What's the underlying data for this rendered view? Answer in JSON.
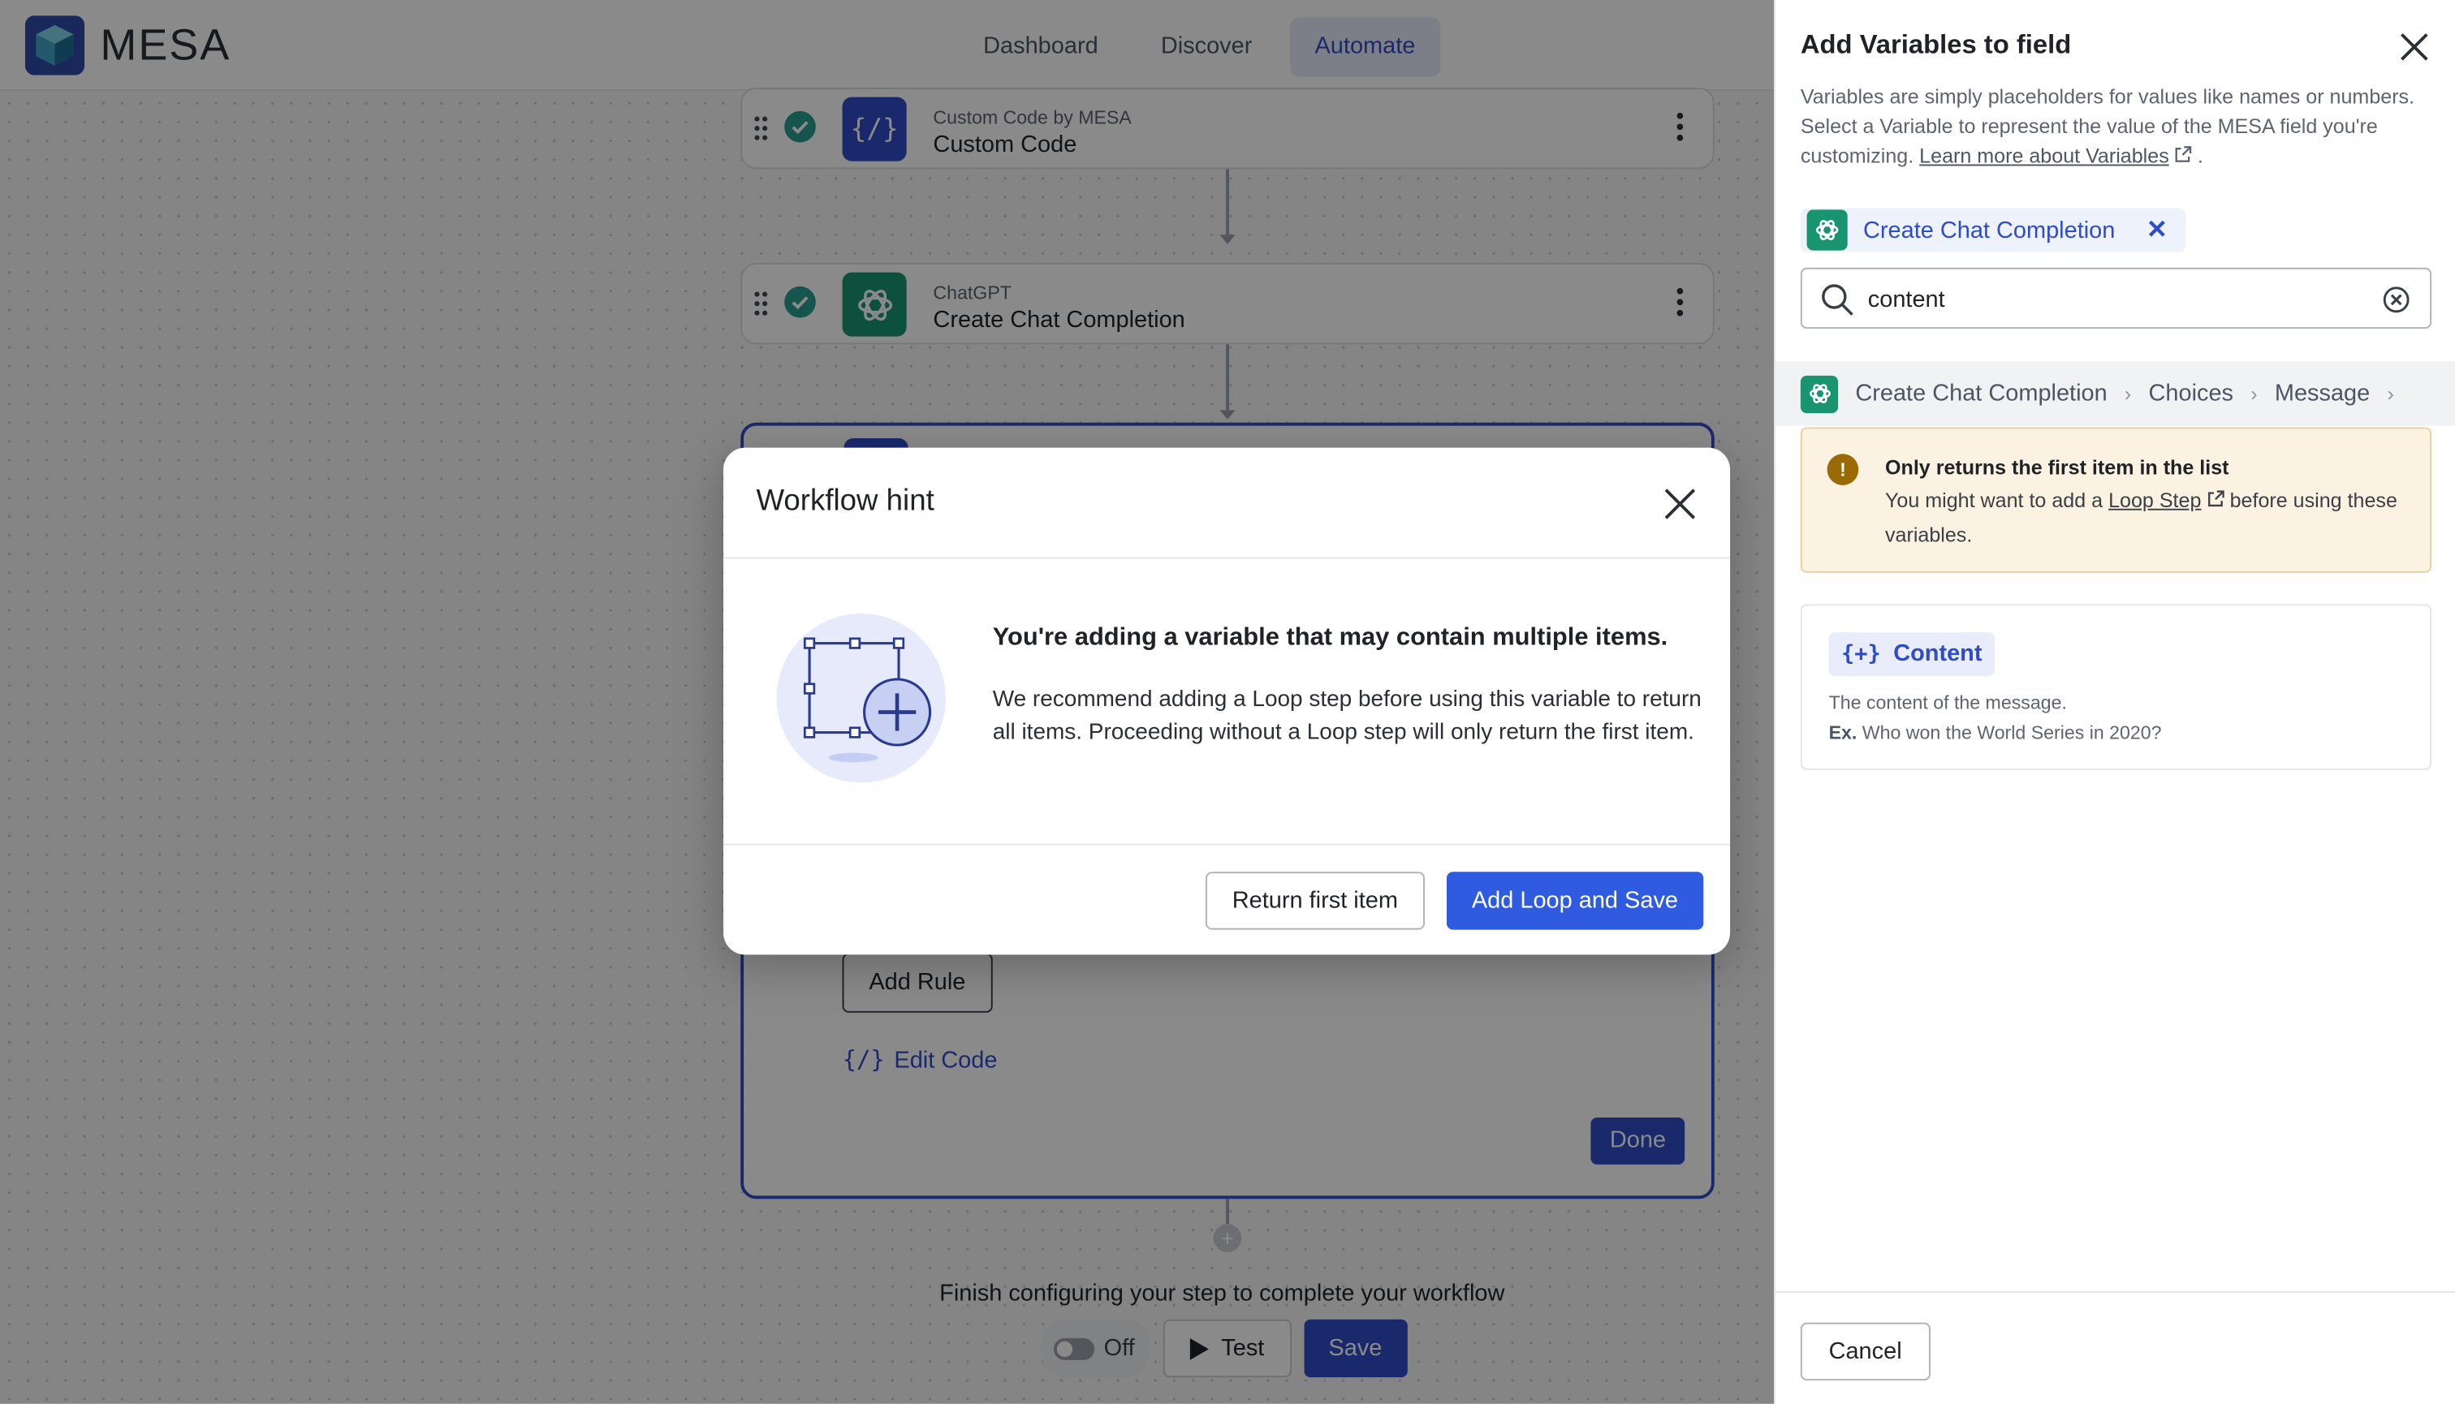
{
  "app": {
    "brand": "MESA",
    "nav": [
      {
        "label": "Dashboard"
      },
      {
        "label": "Discover"
      },
      {
        "label": "Automate"
      }
    ]
  },
  "workflow": {
    "steps": [
      {
        "app": "Custom Code by MESA",
        "title": "Custom Code",
        "icon": "custom-code-icon"
      },
      {
        "app": "ChatGPT",
        "title": "Create Chat Completion",
        "icon": "chatgpt-icon"
      }
    ],
    "open_step": {
      "add_rule_label": "Add Rule",
      "edit_code_label": "Edit Code",
      "done_label": "Done"
    },
    "finish_text": "Finish configuring your step to complete your workflow",
    "toggle_label": "Off",
    "test_label": "Test",
    "save_label": "Save"
  },
  "panel": {
    "title": "Add Variables to field",
    "description_text": "Variables are simply placeholders for values like names or numbers. Select a Variable to represent the value of the MESA field you're customizing.",
    "learn_more_link": "Learn more about Variables",
    "chip_label": "Create Chat Completion",
    "search_value": "content",
    "breadcrumbs": [
      "Create Chat Completion",
      "Choices",
      "Message"
    ],
    "warning": {
      "title": "Only returns the first item in the list",
      "body_prefix": "You might want to add a",
      "link": "Loop Step",
      "body_suffix": "before using these variables."
    },
    "variable": {
      "name": "Content",
      "description": "The content of the message.",
      "example_label": "Ex.",
      "example": "Who won the World Series in 2020?"
    },
    "cancel_label": "Cancel"
  },
  "modal": {
    "title": "Workflow hint",
    "headline": "You're adding a variable that may contain multiple items.",
    "body": "We recommend adding a Loop step before using this variable to return all items. Proceeding without a Loop step will only return the first item.",
    "secondary_label": "Return first item",
    "primary_label": "Add Loop and Save"
  },
  "colors": {
    "accent": "#2f4cc8",
    "primary_button": "#2f5be0",
    "chatgpt": "#18946f",
    "warning_bg": "#fbf2e2",
    "success": "#2a9d8f"
  }
}
